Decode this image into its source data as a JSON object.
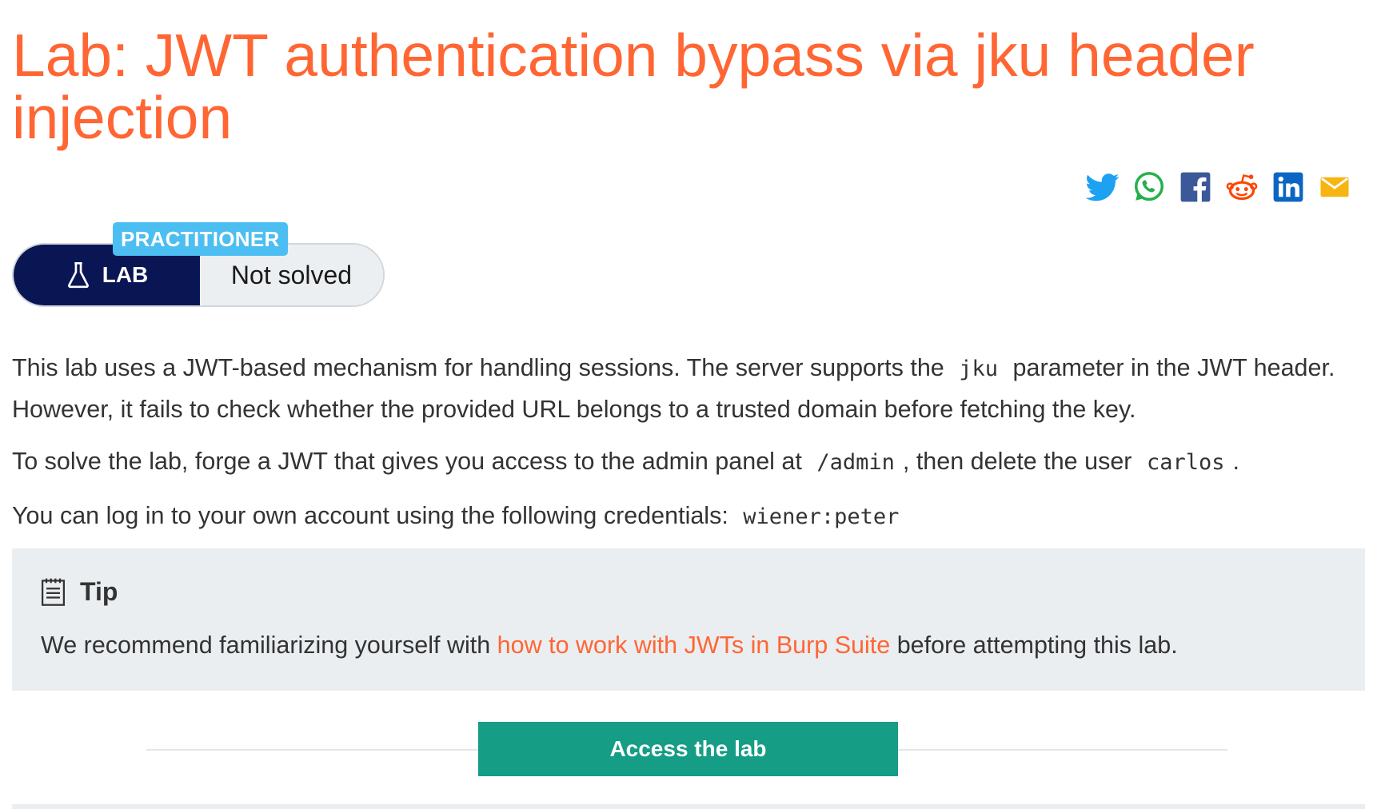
{
  "page": {
    "title": "Lab: JWT authentication bypass via jku header injection"
  },
  "share": {
    "icons": [
      "twitter-icon",
      "whatsapp-icon",
      "facebook-icon",
      "reddit-icon",
      "linkedin-icon",
      "email-icon"
    ]
  },
  "status": {
    "level": "PRACTITIONER",
    "type_label": "LAB",
    "state": "Not solved"
  },
  "description": {
    "p1_before": "This lab uses a JWT-based mechanism for handling sessions. The server supports the",
    "p1_code": "jku",
    "p1_after": "parameter in the JWT header. However, it fails to check whether the provided URL belongs to a trusted domain before fetching the key.",
    "p2_before": "To solve the lab, forge a JWT that gives you access to the admin panel at",
    "p2_code1": "/admin",
    "p2_middle": ", then delete the user",
    "p2_code2": "carlos",
    "p2_end": ".",
    "p3_before": "You can log in to your own account using the following credentials:",
    "p3_code": "wiener:peter"
  },
  "tip": {
    "title": "Tip",
    "before": "We recommend familiarizing yourself with",
    "link": "how to work with JWTs in Burp Suite",
    "after": "before attempting this lab."
  },
  "actions": {
    "access_lab": "Access the lab"
  },
  "colors": {
    "accent": "#ff6633",
    "navy": "#0a1654",
    "badge": "#4cbef2",
    "button": "#159d85",
    "tip_bg": "#eaeef1"
  }
}
